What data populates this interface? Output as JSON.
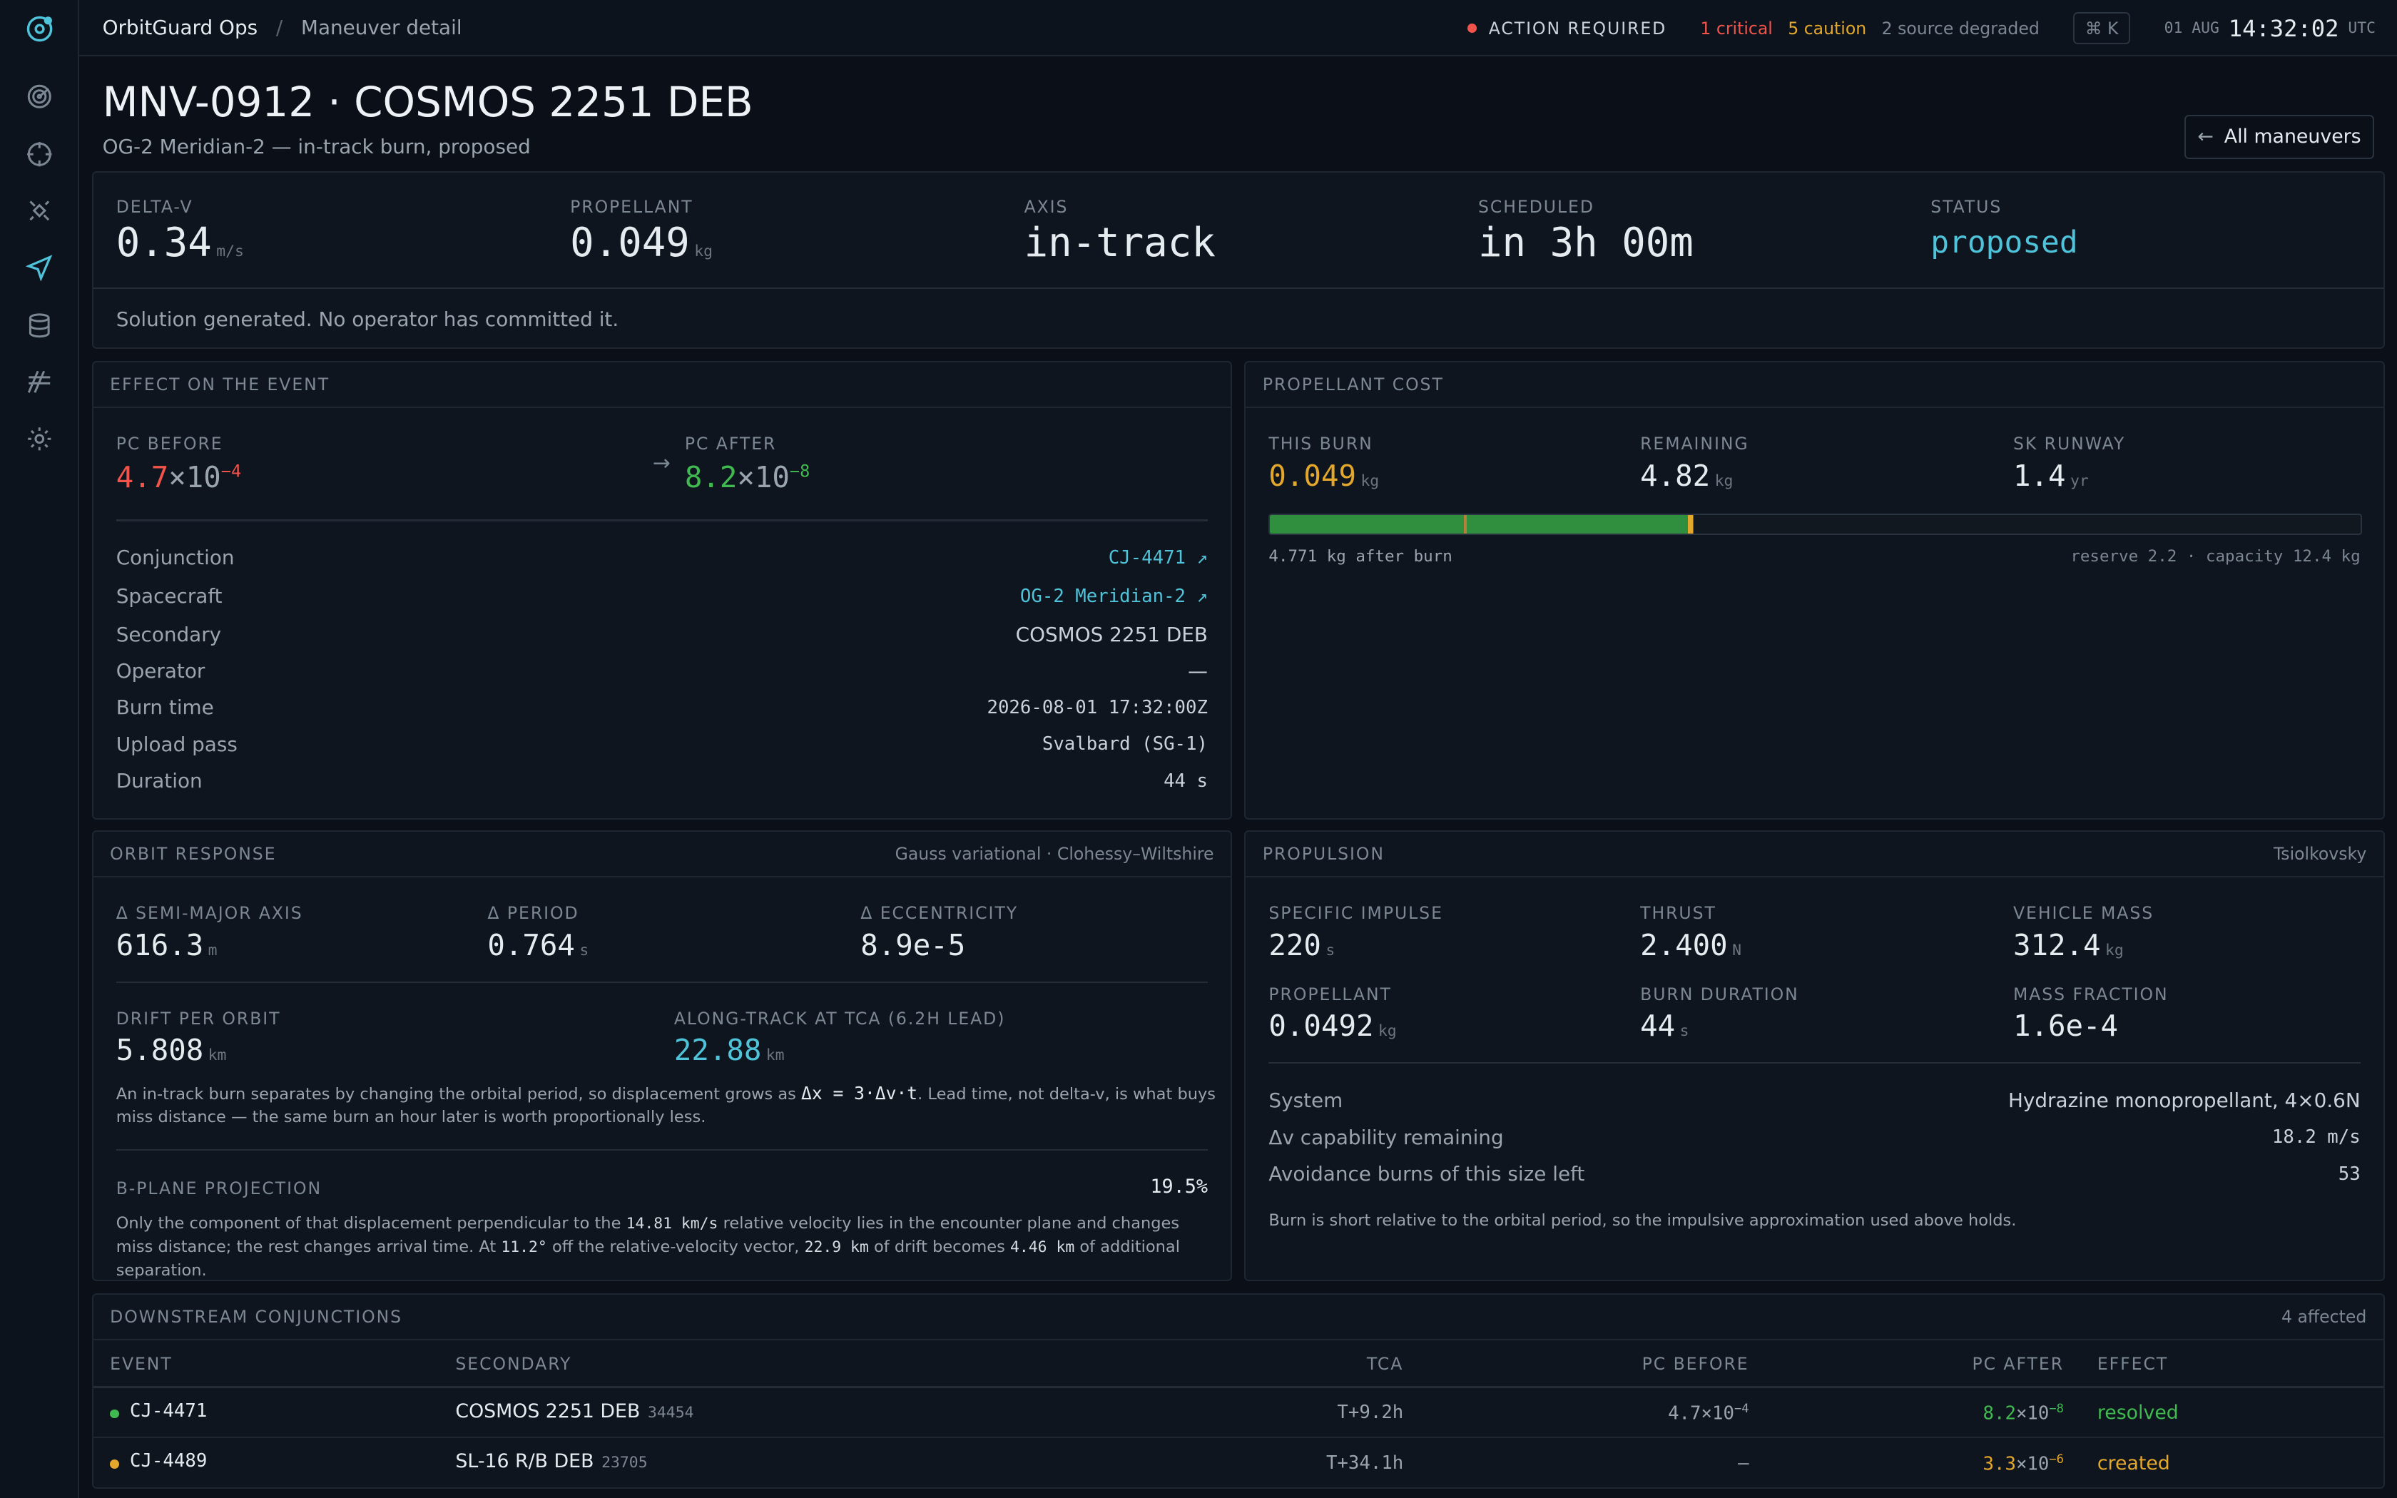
{
  "app": {
    "name": "OrbitGuard Ops",
    "separator": "/",
    "breadcrumb": "Maneuver detail"
  },
  "status": {
    "action": "ACTION REQUIRED",
    "critical": "1 critical",
    "caution": "5 caution",
    "degraded": "2 source degraded",
    "cmd_key": "⌘ K",
    "date": "01 AUG",
    "time": "14:32:02",
    "tz": "UTC"
  },
  "rail": {
    "icons": [
      "orbit-logo-icon",
      "radar-icon",
      "crosshair-icon",
      "satellite-icon",
      "send-icon",
      "database-icon",
      "antenna-icon",
      "settings-icon"
    ]
  },
  "header": {
    "title": "MNV-0912 · COSMOS 2251 DEB",
    "subtitle": "OG-2 Meridian-2 — in-track burn, proposed",
    "back_button": "All maneuvers",
    "back_arrow": "←"
  },
  "summary": {
    "delta_v": {
      "label": "DELTA-V",
      "value": "0.34",
      "unit": "m/s"
    },
    "propellant": {
      "label": "PROPELLANT",
      "value": "0.049",
      "unit": "kg"
    },
    "axis": {
      "label": "AXIS",
      "value": "in-track"
    },
    "scheduled": {
      "label": "SCHEDULED",
      "value": "in 3h 00m"
    },
    "status": {
      "label": "STATUS",
      "value": "proposed"
    },
    "note": "Solution generated. No operator has committed it."
  },
  "effect": {
    "title": "EFFECT ON THE EVENT",
    "pc_before_label": "PC BEFORE",
    "pc_before_mant": "4.7",
    "pc_before_base": "×10",
    "pc_before_exp": "−4",
    "arrow": "→",
    "pc_after_label": "PC AFTER",
    "pc_after_mant": "8.2",
    "pc_after_base": "×10",
    "pc_after_exp": "−8",
    "rows": [
      {
        "k": "Conjunction",
        "v": "CJ-4471 ↗"
      },
      {
        "k": "Spacecraft",
        "v": "OG-2 Meridian-2 ↗"
      },
      {
        "k": "Secondary",
        "v": "COSMOS 2251 DEB"
      },
      {
        "k": "Operator",
        "v": "—"
      },
      {
        "k": "Burn time",
        "v": "2026-08-01 17:32:00Z"
      },
      {
        "k": "Upload pass",
        "v": "Svalbard (SG-1)"
      },
      {
        "k": "Duration",
        "v": "44 s"
      }
    ]
  },
  "cost": {
    "title": "PROPELLANT COST",
    "this_burn": {
      "label": "THIS BURN",
      "value": "0.049",
      "unit": "kg"
    },
    "remaining": {
      "label": "REMAINING",
      "value": "4.82",
      "unit": "kg"
    },
    "runway": {
      "label": "SK RUNWAY",
      "value": "1.4",
      "unit": "yr"
    },
    "bar": {
      "capacity_kg": 12.4,
      "remaining_kg": 4.82,
      "reserve_kg": 2.2,
      "burn_kg": 0.049
    },
    "after_note": "4.771 kg after burn",
    "capacity_note": "reserve 2.2 · capacity 12.4 kg"
  },
  "orbit": {
    "title": "ORBIT RESPONSE",
    "method": "Gauss variational · Clohessy–Wiltshire",
    "sma": {
      "label": "Δ SEMI-MAJOR AXIS",
      "value": "616.3",
      "unit": "m"
    },
    "period": {
      "label": "Δ PERIOD",
      "value": "0.764",
      "unit": "s"
    },
    "ecc": {
      "label": "Δ ECCENTRICITY",
      "value": "8.9e-5"
    },
    "drift": {
      "label": "DRIFT PER ORBIT",
      "value": "5.808",
      "unit": "km"
    },
    "along": {
      "label": "ALONG-TRACK AT TCA (6.2H LEAD)",
      "value": "22.88",
      "unit": "km"
    },
    "note1a": "An in-track burn separates by changing the orbital period, so displacement grows as ",
    "note1_formula": "Δx = 3·Δv·t",
    "note1b": ". Lead time, not delta-v, is what buys miss distance — the same burn an hour later is worth proportionally less.",
    "bplane_label": "B-PLANE PROJECTION",
    "bplane_value": "19.5%",
    "note2a": "Only the component of that displacement perpendicular to the ",
    "note2_v": "14.81 km/s",
    "note2b": " relative velocity lies in the encounter plane and changes miss distance; the rest changes arrival time. At ",
    "note2_ang": "11.2°",
    "note2c": " off the relative-velocity vector, ",
    "note2_drift": "22.9 km",
    "note2d": " of drift becomes ",
    "note2_sep": "4.46 km",
    "note2e": " of additional separation."
  },
  "propulsion": {
    "title": "PROPULSION",
    "method": "Tsiolkovsky",
    "isp": {
      "label": "SPECIFIC IMPULSE",
      "value": "220",
      "unit": "s"
    },
    "thrust": {
      "label": "THRUST",
      "value": "2.400",
      "unit": "N"
    },
    "mass": {
      "label": "VEHICLE MASS",
      "value": "312.4",
      "unit": "kg"
    },
    "prop": {
      "label": "PROPELLANT",
      "value": "0.0492",
      "unit": "kg"
    },
    "burn_dur": {
      "label": "BURN DURATION",
      "value": "44",
      "unit": "s"
    },
    "mass_frac": {
      "label": "MASS FRACTION",
      "value": "1.6e-4"
    },
    "rows": [
      {
        "k": "System",
        "v": "Hydrazine monopropellant, 4×0.6N"
      },
      {
        "k": "Δv capability remaining",
        "v": "18.2 m/s"
      },
      {
        "k": "Avoidance burns of this size left",
        "v": "53"
      }
    ],
    "note": "Burn is short relative to the orbital period, so the impulsive approximation used above holds."
  },
  "downstream": {
    "title": "DOWNSTREAM CONJUNCTIONS",
    "count": "4 affected",
    "headers": [
      "EVENT",
      "SECONDARY",
      "TCA",
      "PC BEFORE",
      "PC AFTER",
      "EFFECT"
    ],
    "rows": [
      {
        "event": "CJ-4471",
        "secondary": "COSMOS 2251 DEB",
        "norad": "34454",
        "tca": "T+9.2h",
        "pc_before_m": "4.7",
        "pc_before_e": "−4",
        "pc_after_m": "8.2",
        "pc_after_e": "−8",
        "effect": "resolved",
        "color": "#3fb950"
      },
      {
        "event": "CJ-4489",
        "secondary": "SL-16 R/B DEB",
        "norad": "23705",
        "tca": "T+34.1h",
        "pc_before": "—",
        "pc_after_m": "3.3",
        "pc_after_e": "−6",
        "effect": "created",
        "color": "#e3a82b"
      }
    ]
  },
  "colors": {
    "accent": "#4fc3d9",
    "critical": "#f2544b",
    "caution": "#e3a82b",
    "good": "#3fb950"
  }
}
